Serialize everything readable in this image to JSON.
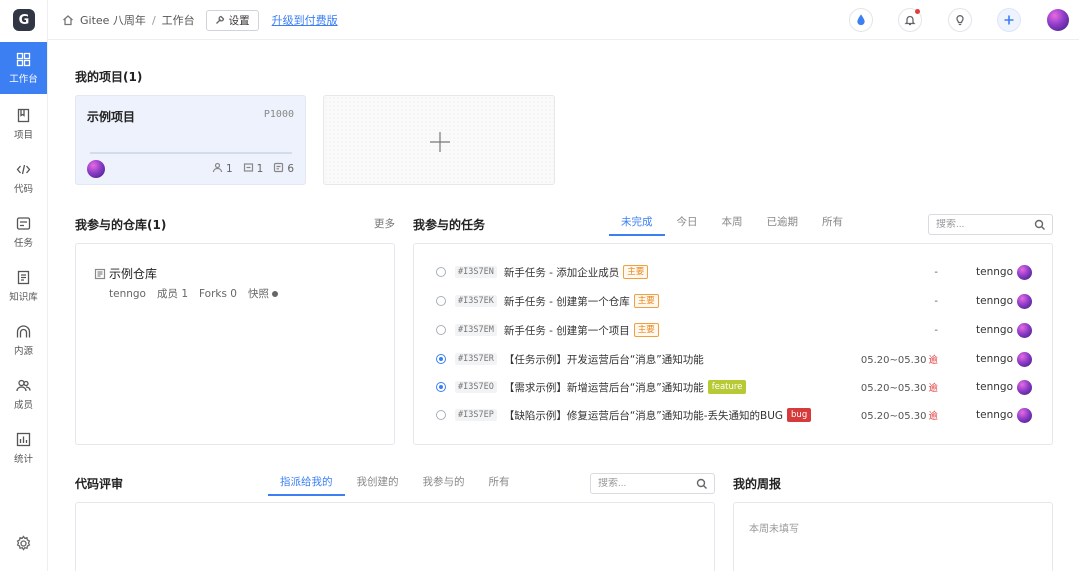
{
  "app": {
    "logo_letter": "G",
    "brand_color": "#c71d23",
    "accent_color": "#3b7ff3"
  },
  "sidebar": {
    "items": [
      {
        "label": "工作台",
        "icon": "grid-icon",
        "active": true
      },
      {
        "label": "项目",
        "icon": "book-icon",
        "active": false
      },
      {
        "label": "代码",
        "icon": "code-icon",
        "active": false
      },
      {
        "label": "任务",
        "icon": "task-icon",
        "active": false
      },
      {
        "label": "知识库",
        "icon": "doc-icon",
        "active": false
      },
      {
        "label": "内源",
        "icon": "arch-icon",
        "active": false
      },
      {
        "label": "成员",
        "icon": "members-icon",
        "active": false
      },
      {
        "label": "统计",
        "icon": "chart-icon",
        "active": false
      }
    ],
    "settings_icon": "gear-icon"
  },
  "header": {
    "breadcrumb": [
      "Gitee 八周年",
      "工作台"
    ],
    "settings_label": "设置",
    "upgrade_label": "升级到付费版",
    "icons": [
      "water-drop-icon",
      "bell-icon",
      "bulb-icon",
      "plus-icon"
    ]
  },
  "projects": {
    "title": "我的项目(1)",
    "items": [
      {
        "name": "示例项目",
        "code": "P1000",
        "members": "1",
        "repos": "1",
        "tasks": "6"
      }
    ]
  },
  "repos": {
    "title": "我参与的仓库(1)",
    "more_label": "更多",
    "items": [
      {
        "name": "示例仓库",
        "owner": "tenngo",
        "members": "成员 1",
        "forks": "Forks 0",
        "snapshot": "快照"
      }
    ]
  },
  "tasks": {
    "title": "我参与的任务",
    "tabs": [
      "未完成",
      "今日",
      "本周",
      "已逾期",
      "所有"
    ],
    "search_placeholder": "搜索...",
    "overdue_label": "逾",
    "rows": [
      {
        "id": "#I3S7EN",
        "title": "新手任务 - 添加企业成员",
        "tag": "主要",
        "tag_type": "main",
        "date": "-",
        "overdue": false,
        "assignee": "tenngo",
        "state": "todo"
      },
      {
        "id": "#I3S7EK",
        "title": "新手任务 - 创建第一个仓库",
        "tag": "主要",
        "tag_type": "main",
        "date": "-",
        "overdue": false,
        "assignee": "tenngo",
        "state": "todo"
      },
      {
        "id": "#I3S7EM",
        "title": "新手任务 - 创建第一个项目",
        "tag": "主要",
        "tag_type": "main",
        "date": "-",
        "overdue": false,
        "assignee": "tenngo",
        "state": "todo"
      },
      {
        "id": "#I3S7ER",
        "title": "【任务示例】开发运营后台“消息”通知功能",
        "tag": "",
        "tag_type": "",
        "date": "05.20~05.30",
        "overdue": true,
        "assignee": "tenngo",
        "state": "progress"
      },
      {
        "id": "#I3S7EO",
        "title": "【需求示例】新增运营后台“消息”通知功能",
        "tag": "feature",
        "tag_type": "feature",
        "date": "05.20~05.30",
        "overdue": true,
        "assignee": "tenngo",
        "state": "progress"
      },
      {
        "id": "#I3S7EP",
        "title": "【缺陷示例】修复运营后台“消息”通知功能-丢失通知的BUG",
        "tag": "bug",
        "tag_type": "bug",
        "date": "05.20~05.30",
        "overdue": true,
        "assignee": "tenngo",
        "state": "todo"
      }
    ]
  },
  "code_review": {
    "title": "代码评审",
    "tabs": [
      "指派给我的",
      "我创建的",
      "我参与的",
      "所有"
    ],
    "search_placeholder": "搜索..."
  },
  "weekly": {
    "title": "我的周报",
    "empty_text": "本周未填写"
  }
}
